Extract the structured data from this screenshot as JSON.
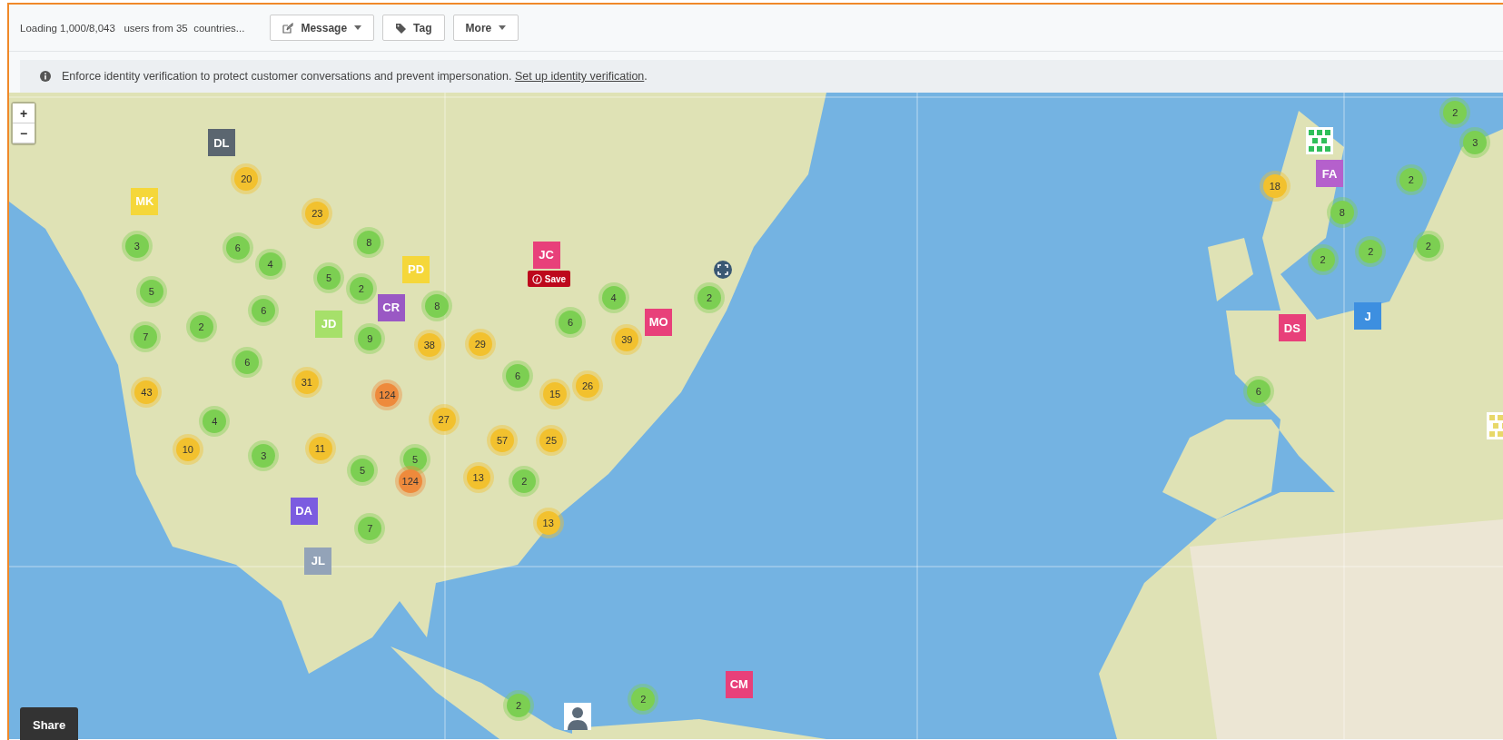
{
  "toolbar": {
    "status": "Loading 1,000/8,043   users from 35  countries...",
    "buttons": [
      {
        "label": "Message",
        "kind": "message",
        "dropdown": true
      },
      {
        "label": "Tag",
        "kind": "tag",
        "dropdown": false
      },
      {
        "label": "More",
        "kind": "more",
        "dropdown": true
      }
    ]
  },
  "banner": {
    "text": "Enforce identity verification to protect customer conversations and prevent impersonation. ",
    "link": "Set up identity verification",
    "after": "."
  },
  "map": {
    "zoom_controls": [
      "+",
      "−"
    ],
    "clusters": [
      {
        "count": "20",
        "color": "#f2c12e"
      },
      {
        "count": "23",
        "color": "#f2c12e"
      },
      {
        "count": "3",
        "color": "#7ccf52"
      },
      {
        "count": "6",
        "color": "#7ccf52"
      },
      {
        "count": "4",
        "color": "#7ccf52"
      },
      {
        "count": "8",
        "color": "#7ccf52"
      },
      {
        "count": "5",
        "color": "#7ccf52"
      },
      {
        "count": "2",
        "color": "#7ccf52"
      },
      {
        "count": "5",
        "color": "#7ccf52"
      },
      {
        "count": "6",
        "color": "#7ccf52"
      },
      {
        "count": "2",
        "color": "#7ccf52"
      },
      {
        "count": "7",
        "color": "#7ccf52"
      },
      {
        "count": "8",
        "color": "#7ccf52"
      },
      {
        "count": "9",
        "color": "#7ccf52"
      },
      {
        "count": "38",
        "color": "#f2c12e"
      },
      {
        "count": "29",
        "color": "#f2c12e"
      },
      {
        "count": "6",
        "color": "#7ccf52"
      },
      {
        "count": "4",
        "color": "#7ccf52"
      },
      {
        "count": "39",
        "color": "#f2c12e"
      },
      {
        "count": "2",
        "color": "#7ccf52"
      },
      {
        "count": "6",
        "color": "#7ccf52"
      },
      {
        "count": "43",
        "color": "#f2c12e"
      },
      {
        "count": "31",
        "color": "#f2c12e"
      },
      {
        "count": "124",
        "color": "#ee8a3c"
      },
      {
        "count": "6",
        "color": "#7ccf52"
      },
      {
        "count": "15",
        "color": "#f2c12e"
      },
      {
        "count": "26",
        "color": "#f2c12e"
      },
      {
        "count": "27",
        "color": "#f2c12e"
      },
      {
        "count": "4",
        "color": "#7ccf52"
      },
      {
        "count": "10",
        "color": "#f2c12e"
      },
      {
        "count": "3",
        "color": "#7ccf52"
      },
      {
        "count": "11",
        "color": "#f2c12e"
      },
      {
        "count": "57",
        "color": "#f2c12e"
      },
      {
        "count": "25",
        "color": "#f2c12e"
      },
      {
        "count": "5",
        "color": "#7ccf52"
      },
      {
        "count": "5",
        "color": "#7ccf52"
      },
      {
        "count": "124",
        "color": "#ee8a3c"
      },
      {
        "count": "13",
        "color": "#f2c12e"
      },
      {
        "count": "2",
        "color": "#7ccf52"
      },
      {
        "count": "13",
        "color": "#f2c12e"
      },
      {
        "count": "7",
        "color": "#7ccf52"
      },
      {
        "count": "2",
        "color": "#7ccf52"
      },
      {
        "count": "2",
        "color": "#7ccf52"
      },
      {
        "count": "18",
        "color": "#f2c12e"
      },
      {
        "count": "2",
        "color": "#7ccf52"
      },
      {
        "count": "3",
        "color": "#7ccf52"
      },
      {
        "count": "2",
        "color": "#7ccf52"
      },
      {
        "count": "8",
        "color": "#7ccf52"
      },
      {
        "count": "2",
        "color": "#7ccf52"
      },
      {
        "count": "2",
        "color": "#7ccf52"
      },
      {
        "count": "2",
        "color": "#7ccf52"
      },
      {
        "count": "6",
        "color": "#7ccf52"
      }
    ],
    "avatars": [
      {
        "kind": "initials",
        "initials": "DL",
        "color": "#5b6670"
      },
      {
        "kind": "initials",
        "initials": "MK",
        "color": "#f5d73a"
      },
      {
        "kind": "initials",
        "initials": "PD",
        "color": "#f5d73a"
      },
      {
        "kind": "initials",
        "initials": "JC",
        "color": "#e8407a"
      },
      {
        "kind": "initials",
        "initials": "CR",
        "color": "#9a58c4"
      },
      {
        "kind": "initials",
        "initials": "JD",
        "color": "#a6e06a"
      },
      {
        "kind": "initials",
        "initials": "MO",
        "color": "#e8407a"
      },
      {
        "kind": "initials",
        "initials": "DA",
        "color": "#7b5ce0"
      },
      {
        "kind": "initials",
        "initials": "JL",
        "color": "#93a3b8"
      },
      {
        "kind": "initials",
        "initials": "CM",
        "color": "#e8407a"
      },
      {
        "kind": "initials",
        "initials": "FA",
        "color": "#b560cc"
      },
      {
        "kind": "initials",
        "initials": "DS",
        "color": "#e8407a"
      },
      {
        "kind": "initials",
        "initials": "J",
        "color": "#3d8fe0"
      },
      {
        "kind": "photo"
      },
      {
        "kind": "pattern",
        "color": "#2fbf5a"
      },
      {
        "kind": "pattern",
        "color": "#e8d86a"
      }
    ],
    "save_button": "Save",
    "share_button": "Share"
  }
}
